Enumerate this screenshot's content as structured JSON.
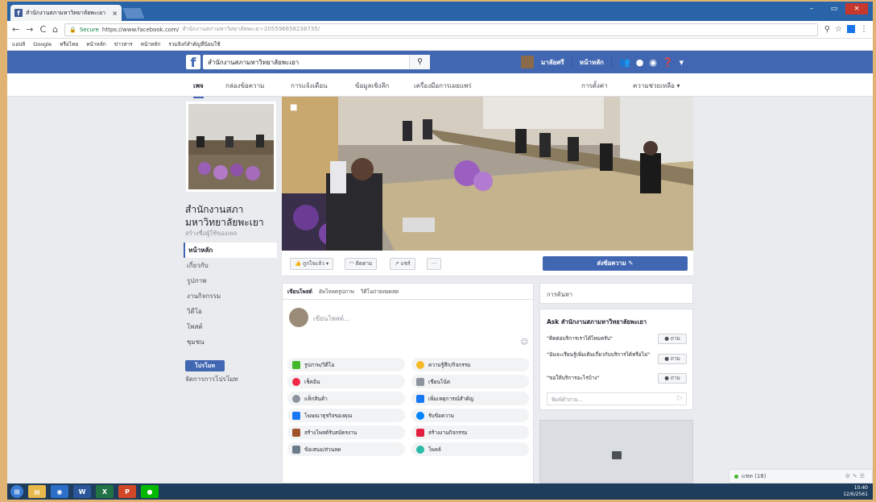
{
  "browser": {
    "tab_title": "สำนักงานสภามหาวิทยาลัยพะเยา",
    "tab_close": "×",
    "secure_label": "Secure",
    "url_host": "https://www.facebook.com/",
    "url_path": "สำนักงานสภามหาวิทยาลัยพะเยา-205596658238735/",
    "bookmarks": [
      "แอปส์",
      "Google",
      "หรือไทย",
      "หน้าหลัก",
      "ข่าวสาร",
      "หน้าหลัก",
      "รวมลิงก์สำคัญที่นิยมใช้"
    ]
  },
  "fb": {
    "search_value": "สำนักงานสภามหาวิทยาลัยพะเยา",
    "user_name": "มาลัยศรี",
    "home_label": "หน้าหลัก",
    "tabs": [
      "เพจ",
      "กล่องข้อความ",
      "การแจ้งเตือน",
      "ข้อมูลเชิงลึก",
      "เครื่องมือการเผยแพร่"
    ],
    "settings_label": "การตั้งค่า",
    "help_label": "ความช่วยเหลือ ▾"
  },
  "left": {
    "page_name": "สำนักงานสภามหาวิทยาลัยพะเยา",
    "page_sub": "สร้างชื่อผู้ใช้ของเพจ",
    "nav": [
      "หน้าหลัก",
      "เกี่ยวกับ",
      "รูปภาพ",
      "งานกิจกรรม",
      "วิดีโอ",
      "โพสต์",
      "ชุมชน"
    ],
    "promote_btn": "โปรโมท",
    "promo_link": "จัดการการโปรโมท"
  },
  "actions": {
    "like": "ถูกใจแล้ว ▾",
    "follow": "ติดตาม",
    "share": "แชร์",
    "more": "···",
    "send_message": "ส่งข้อความ ✎"
  },
  "composer": {
    "tabs": [
      "เขียนโพสต์",
      "อัพโหลดรูปภาพ",
      "วิดีโอถ่ายทอดสด"
    ],
    "placeholder": "เขียนโพสต์...",
    "options": [
      "รูปภาพ/วิดีโอ",
      "ความรู้สึก/กิจกรรม",
      "เช็คอิน",
      "เขียนโน้ต",
      "แท็กสินค้า",
      "เพิ่มเหตุการณ์สำคัญ",
      "โฆษณาธุรกิจของคุณ",
      "รับข้อความ",
      "สร้างโพสต์รับสมัครงาน",
      "สร้างงานกิจกรรม",
      "ข้อเสนอ/ส่วนลด",
      "โพลล์"
    ]
  },
  "right": {
    "suggest_title": "การค้นหา",
    "ask_title": "Ask สำนักงานสภามหาวิทยาลัยพะเยา",
    "questions": [
      "\"ติดต่อบริการเราได้ไหมครับ\"",
      "\"ฉันจะเรียนรู้เพิ่มเติมเกี่ยวกับบริการได้หรือไม่\"",
      "\"ขอให้บริการอะไรบ้าง\""
    ],
    "ask_btn": "● ถาม",
    "ask_input": "พิมพ์คำถาม..."
  },
  "chat": {
    "label": "แชท (18)"
  },
  "tray": {
    "time": "10:40",
    "date": "12/6/2561"
  }
}
